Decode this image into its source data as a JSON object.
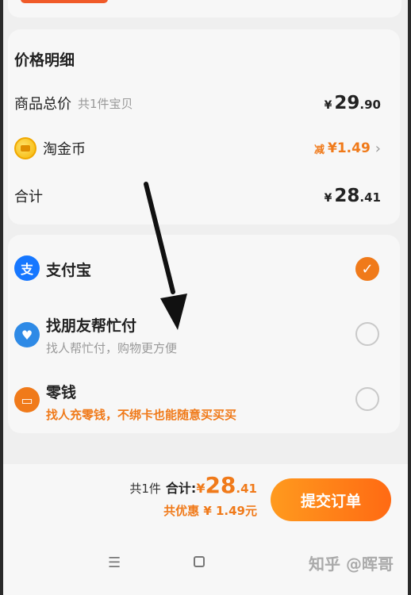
{
  "price_detail": {
    "title": "价格明细",
    "goods_label": "商品总价",
    "goods_count": "共1件宝贝",
    "goods_price": {
      "yen": "¥",
      "int": "29",
      "dec": ".90"
    },
    "coin_label": "淘金币",
    "coin_discount_tag": "减",
    "coin_discount": "¥1.49",
    "total_label": "合计",
    "total_price": {
      "yen": "¥",
      "int": "28",
      "dec": ".41"
    }
  },
  "payment_methods": [
    {
      "name": "支付宝",
      "desc": "",
      "selected": true,
      "icon": "alipay-icon",
      "color": "#1677ff"
    },
    {
      "name": "找朋友帮忙付",
      "desc": "找人帮忙付，购物更方便",
      "selected": false,
      "icon": "friend-pay-icon",
      "color": "#2e8ae6"
    },
    {
      "name": "零钱",
      "desc": "找人充零钱，不绑卡也能随意买买买",
      "selected": false,
      "icon": "wallet-icon",
      "color": "#f07a1a"
    }
  ],
  "footer": {
    "count": "共1件",
    "total_label": "合计:",
    "total_price": {
      "yen": "¥",
      "int": "28",
      "dec": ".41"
    },
    "saving": "共优惠 ¥ 1.49元",
    "submit_label": "提交订单"
  },
  "navbar": {
    "menu_glyph": "☰",
    "watermark": "知乎 @晖哥"
  },
  "colors": {
    "accent": "#f07a1a",
    "background": "#efefef",
    "card": "#f7f7f7"
  }
}
